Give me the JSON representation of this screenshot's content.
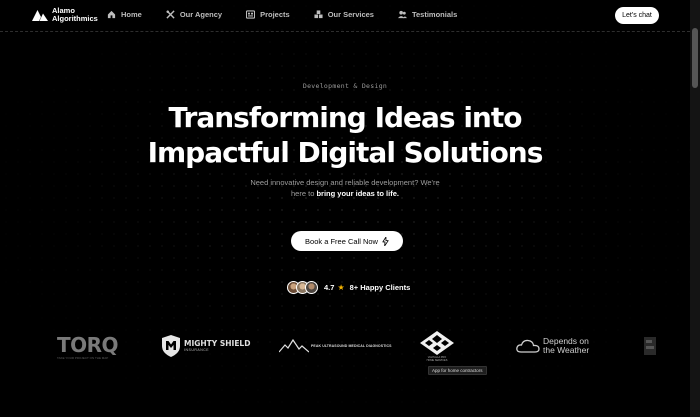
{
  "header": {
    "logo_line1": "Alamo",
    "logo_line2": "Algorithmics",
    "nav": [
      {
        "label": "Home",
        "icon": "home-icon"
      },
      {
        "label": "Our Agency",
        "icon": "tools-icon"
      },
      {
        "label": "Projects",
        "icon": "grid-icon"
      },
      {
        "label": "Our Services",
        "icon": "boxes-icon"
      },
      {
        "label": "Testimonials",
        "icon": "users-icon"
      }
    ],
    "chat_label": "Let's chat"
  },
  "hero": {
    "eyebrow": "Development & Design",
    "title_line1": "Transforming Ideas into",
    "title_line2": "Impactful Digital Solutions",
    "subtitle_line1": "Need innovative design and reliable development? We're",
    "subtitle_line2_plain": "here to",
    "subtitle_line2_highlight": "bring your ideas to life.",
    "cta_label": "Book a Free Call Now",
    "rating": "4.7",
    "clients": "8+ Happy Clients"
  },
  "brands": {
    "torq": "TORQ",
    "torq_tag": "TAKE YOUR PROJECT ON THE MAP",
    "mighty_shield": "MIGHTY SHIELD",
    "mighty_shield_sub": "INSURANCE",
    "mountain": "PEAK ULTRASOUND MEDICAL DIAGNOSTICS",
    "venture_sub_line1": "VALHALLA PRO",
    "venture_sub_line2": "HOME SERVICES",
    "tooltip": "App for home contractors",
    "weather_line1": "Depends on",
    "weather_line2": "the Weather"
  },
  "colors": {
    "background": "#000000",
    "accent_star": "#f5b400"
  }
}
